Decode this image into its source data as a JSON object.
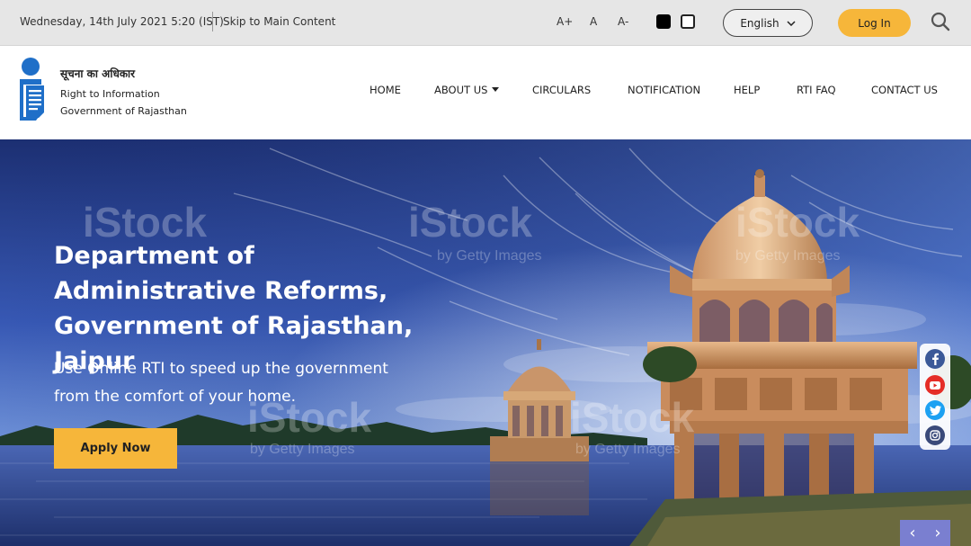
{
  "topbar": {
    "date": "Wednesday, 14th July 2021 5:20 (IST)",
    "skip": "Skip to Main Content",
    "font_increase": "A+",
    "font_normal": "A",
    "font_decrease": "A-",
    "language": "English",
    "login": "Log In"
  },
  "logo": {
    "hindi": "सूचना का अधिकार",
    "line1": "Right to Information",
    "line2": "Government of Rajasthan"
  },
  "nav": {
    "home": "HOME",
    "about": "ABOUT US",
    "circulars": "CIRCULARS",
    "notification": "NOTIFICATION",
    "help": "HELP",
    "faq": "RTI FAQ",
    "contact": "CONTACT US"
  },
  "hero": {
    "title": "Department of Administrative Reforms, Government of Rajasthan, Jaipur",
    "subtitle": "Use Online RTI to speed up the government from the comfort of your home.",
    "cta": "Apply Now",
    "watermark": "iStock",
    "watermark_sub": "by Getty Images",
    "prev": "‹",
    "next": "›"
  },
  "colors": {
    "accent": "#f6b63a",
    "logo_blue": "#1f6fc8",
    "facebook": "#3b5998",
    "youtube": "#e52d27",
    "twitter": "#1da1f2",
    "instagram": "#3a4a7a"
  },
  "icons": {
    "search": "search-icon",
    "facebook": "facebook-icon",
    "youtube": "youtube-icon",
    "twitter": "twitter-icon",
    "instagram": "instagram-icon"
  }
}
